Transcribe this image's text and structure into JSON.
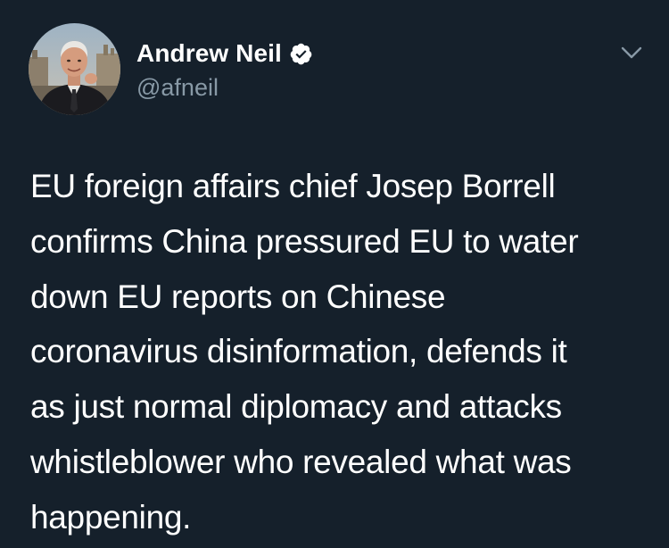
{
  "author": {
    "display_name": "Andrew Neil",
    "handle": "@afneil",
    "verified": true,
    "avatar_icon": "profile-photo"
  },
  "tweet": {
    "text": "EU foreign affairs chief Josep Borrell\nconfirms China pressured EU to water\ndown EU reports on Chinese\ncoronavirus disinformation, defends it\nas just normal diplomacy and attacks\nwhistleblower who revealed what was\nhappening."
  },
  "menu": {
    "icon": "chevron-down-icon"
  },
  "colors": {
    "background": "#15202b",
    "text": "#ffffff",
    "secondary_text": "#8899a6",
    "verified_badge": "#ffffff"
  }
}
